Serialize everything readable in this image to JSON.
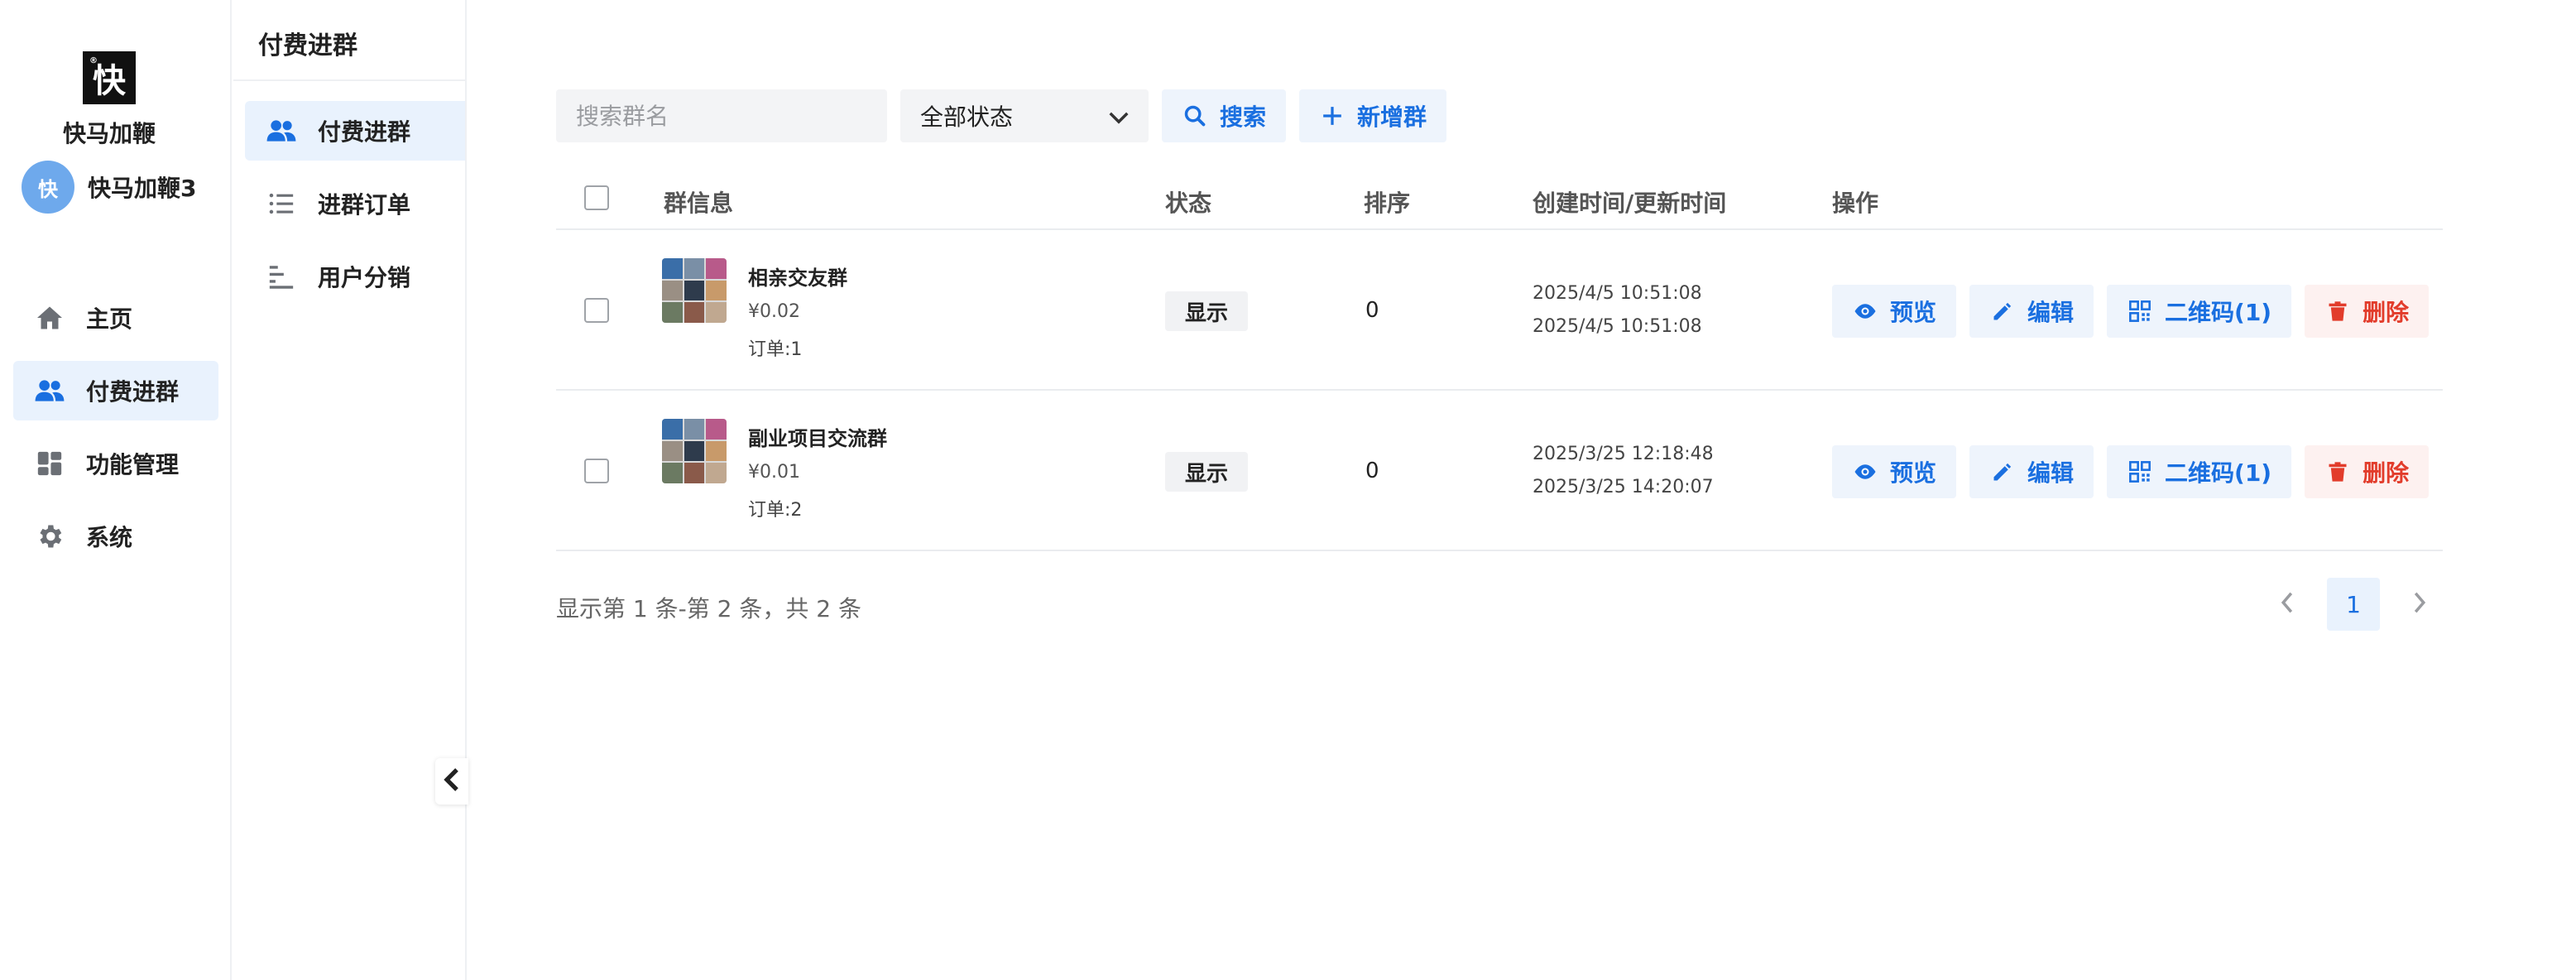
{
  "sidebar": {
    "logo_text": "快",
    "brand_name": "快马加鞭",
    "user": {
      "avatar_text": "快",
      "name": "快马加鞭3"
    },
    "items": [
      {
        "label": "主页",
        "icon": "home-icon",
        "active": false
      },
      {
        "label": "付费进群",
        "icon": "users-icon",
        "active": true
      },
      {
        "label": "功能管理",
        "icon": "grid-icon",
        "active": false
      },
      {
        "label": "系统",
        "icon": "gear-icon",
        "active": false
      }
    ]
  },
  "subnav": {
    "title": "付费进群",
    "items": [
      {
        "label": "付费进群",
        "icon": "users-icon",
        "active": true
      },
      {
        "label": "进群订单",
        "icon": "list-icon",
        "active": false
      },
      {
        "label": "用户分销",
        "icon": "bars-icon",
        "active": false
      }
    ]
  },
  "toolbar": {
    "search_placeholder": "搜索群名",
    "status_select": "全部状态",
    "search_button": "搜索",
    "add_button": "新增群"
  },
  "table": {
    "headers": {
      "info": "群信息",
      "status": "状态",
      "sort": "排序",
      "time": "创建时间/更新时间",
      "actions": "操作"
    },
    "rows": [
      {
        "name": "相亲交友群",
        "price": "¥0.02",
        "orders": "订单:1",
        "status": "显示",
        "sort": "0",
        "created": "2025/4/5 10:51:08",
        "updated": "2025/4/5 10:51:08",
        "preview": "预览",
        "edit": "编辑",
        "qrcode": "二维码(1)",
        "delete": "删除"
      },
      {
        "name": "副业项目交流群",
        "price": "¥0.01",
        "orders": "订单:2",
        "status": "显示",
        "sort": "0",
        "created": "2025/3/25 12:18:48",
        "updated": "2025/3/25 14:20:07",
        "preview": "预览",
        "edit": "编辑",
        "qrcode": "二维码(1)",
        "delete": "删除"
      }
    ]
  },
  "footer": {
    "summary": "显示第 1 条-第 2 条，共 2 条",
    "current_page": "1"
  },
  "colors": {
    "accent": "#1a6fe0",
    "accent_bg": "#e9f2fd",
    "danger": "#e23c2b",
    "avatar": "#6ea9ec"
  }
}
